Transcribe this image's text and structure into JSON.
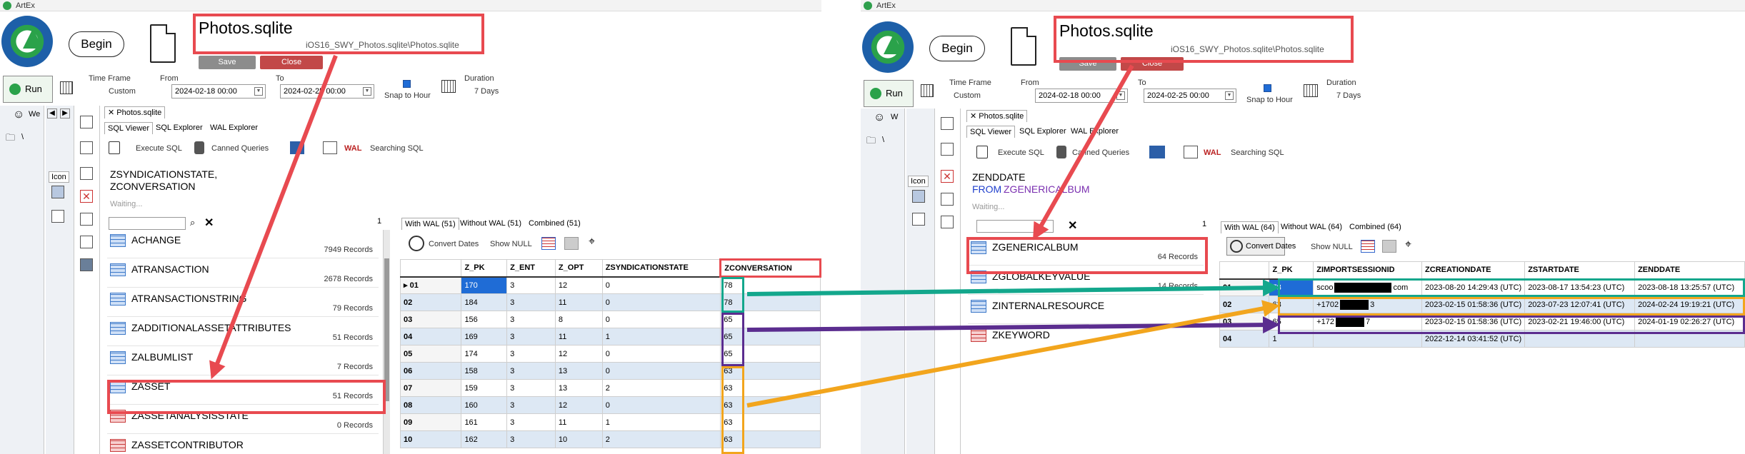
{
  "app": {
    "title": "ArtEx"
  },
  "left": {
    "begin": "Begin",
    "file_name": "Photos.sqlite",
    "file_path": "iOS16_SWY_Photos.sqlite\\Photos.sqlite",
    "save": "Save",
    "close": "Close",
    "run": "Run",
    "time_frame_label": "Time Frame",
    "time_frame_value": "Custom",
    "from_label": "From",
    "from_value": "2024-02-18 00:00",
    "to_label": "To",
    "to_value": "2024-02-25 00:00",
    "snap": "Snap to Hour",
    "duration_label": "Duration",
    "duration_value": "7 Days",
    "doc_tab": "Photos.sqlite",
    "tabs": [
      "SQL Viewer",
      "SQL Explorer",
      "WAL Explorer"
    ],
    "toolbar": {
      "execute": "Execute SQL",
      "canned": "Canned Queries",
      "searching": "Searching SQL",
      "wal": "WAL"
    },
    "sql_lines": [
      "ZSYNDICATIONSTATE,",
      "ZCONVERSATION"
    ],
    "waiting": "Waiting...",
    "side_icon_label": "Icon",
    "side_we": "We",
    "backslash": "\\",
    "count_one": "1",
    "tables": [
      {
        "name": "ACHANGE",
        "count": "7949 Records"
      },
      {
        "name": "ATRANSACTION",
        "count": "2678 Records"
      },
      {
        "name": "ATRANSACTIONSTRING",
        "count": "79 Records"
      },
      {
        "name": "ZADDITIONALASSETATTRIBUTES",
        "count": "51 Records"
      },
      {
        "name": "ZALBUMLIST",
        "count": "7 Records"
      },
      {
        "name": "ZASSET",
        "count": "51 Records"
      },
      {
        "name": "ZASSETANALYSISSTATE",
        "count": "0 Records"
      },
      {
        "name": "ZASSETCONTRIBUTOR",
        "count": ""
      }
    ],
    "result_tabs": [
      "With WAL (51)",
      "Without WAL (51)",
      "Combined (51)"
    ],
    "convert_dates": "Convert Dates",
    "show_null": "Show NULL",
    "columns": [
      "",
      "Z_PK",
      "Z_ENT",
      "Z_OPT",
      "ZSYNDICATIONSTATE",
      "ZCONVERSATION"
    ],
    "rows": [
      [
        "01",
        "170",
        "3",
        "12",
        "0",
        "78"
      ],
      [
        "02",
        "184",
        "3",
        "11",
        "0",
        "78"
      ],
      [
        "03",
        "156",
        "3",
        "8",
        "0",
        "65"
      ],
      [
        "04",
        "169",
        "3",
        "11",
        "1",
        "65"
      ],
      [
        "05",
        "174",
        "3",
        "12",
        "0",
        "65"
      ],
      [
        "06",
        "158",
        "3",
        "13",
        "0",
        "63"
      ],
      [
        "07",
        "159",
        "3",
        "13",
        "2",
        "63"
      ],
      [
        "08",
        "160",
        "3",
        "12",
        "0",
        "63"
      ],
      [
        "09",
        "161",
        "3",
        "11",
        "1",
        "63"
      ],
      [
        "10",
        "162",
        "3",
        "10",
        "2",
        "63"
      ]
    ]
  },
  "right": {
    "begin": "Begin",
    "file_name": "Photos.sqlite",
    "file_path": "iOS16_SWY_Photos.sqlite\\Photos.sqlite",
    "save": "Save",
    "close": "Close",
    "run": "Run",
    "time_frame_label": "Time Frame",
    "time_frame_value": "Custom",
    "from_label": "From",
    "from_value": "2024-02-18 00:00",
    "to_label": "To",
    "to_value": "2024-02-25 00:00",
    "snap": "Snap to Hour",
    "duration_label": "Duration",
    "duration_value": "7 Days",
    "doc_tab": "Photos.sqlite",
    "tabs": [
      "SQL Viewer",
      "SQL Explorer",
      "WAL Explorer"
    ],
    "toolbar": {
      "execute": "Execute SQL",
      "canned": "Canned Queries",
      "searching": "Searching SQL",
      "wal": "WAL"
    },
    "sql_line1": "ZENDDATE",
    "sql_from": "FROM",
    "sql_table": "ZGENERICALBUM",
    "waiting": "Waiting...",
    "side_icon_label": "Icon",
    "side_we": "W",
    "backslash": "\\",
    "count_one": "1",
    "tables": [
      {
        "name": "ZGENERICALBUM",
        "count": "64 Records"
      },
      {
        "name": "ZGLOBALKEYVALUE",
        "count": "14 Records"
      },
      {
        "name": "ZINTERNALRESOURCE",
        "count": ""
      },
      {
        "name": "ZKEYWORD",
        "count": ""
      }
    ],
    "result_tabs": [
      "With WAL (64)",
      "Without WAL (64)",
      "Combined (64)"
    ],
    "convert_dates": "Convert Dates",
    "show_null": "Show NULL",
    "columns": [
      "",
      "Z_PK",
      "ZIMPORTSESSIONID",
      "ZCREATIONDATE",
      "ZSTARTDATE",
      "ZENDDATE"
    ],
    "rows": [
      [
        "01",
        "78",
        "scoo",
        "com",
        "",
        "2023-08-20  14:29:43 (UTC)",
        "2023-08-17  13:54:23 (UTC)",
        "2023-08-18  13:25:57 (UTC)"
      ],
      [
        "02",
        "63",
        "+1702",
        "3",
        "2023-02-15  01:58:36 (UTC)",
        "2023-07-23  12:07:41 (UTC)",
        "2024-02-24  19:19:21 (UTC)"
      ],
      [
        "03",
        "65",
        "+172",
        "7",
        "2023-02-15  01:58:36 (UTC)",
        "2023-02-21  19:46:00 (UTC)",
        "2024-01-19  02:26:27 (UTC)"
      ],
      [
        "04",
        "1",
        "",
        "",
        "2022-12-14  03:41:52 (UTC)",
        "",
        ""
      ]
    ]
  },
  "colors": {
    "red": "#e84a50",
    "teal": "#13a78c",
    "purple": "#5b2d8f",
    "orange": "#f2a51d",
    "blue": "#1f6cd6"
  }
}
